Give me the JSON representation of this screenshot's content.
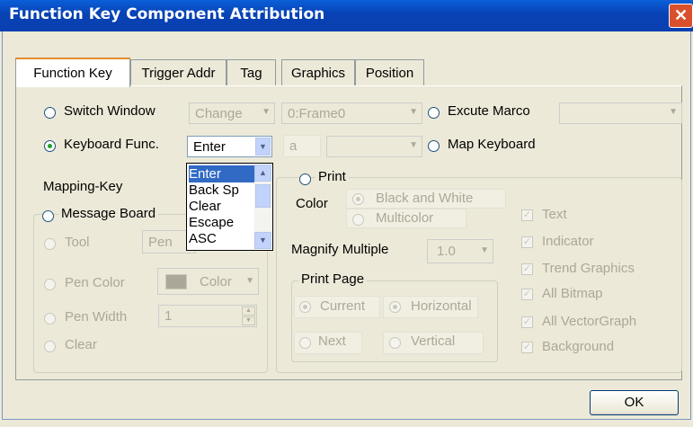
{
  "window": {
    "title": "Function Key Component Attribution",
    "close_glyph": "✕"
  },
  "tabs": [
    {
      "label": "Function Key"
    },
    {
      "label": "Trigger Addr"
    },
    {
      "label": "Tag"
    },
    {
      "label": "Graphics"
    },
    {
      "label": "Position"
    }
  ],
  "func": {
    "switch_window": "Switch Window",
    "switch_combo": "Change",
    "frame_combo": "0:Frame0",
    "excute_marco": "Excute Marco",
    "keyboard_func": "Keyboard Func.",
    "keyboard_combo": "Enter",
    "a_field": "a",
    "map_keyboard": "Map Keyboard",
    "mapping_key": "Mapping-Key",
    "dropdown_items": [
      "Enter",
      "Back Sp",
      "Clear",
      "Escape",
      "ASC"
    ]
  },
  "message_board": {
    "title": "Message Board",
    "tool": "Tool",
    "tool_combo": "Pen",
    "pen_color": "Pen Color",
    "color_combo": "Color",
    "pen_width": "Pen Width",
    "pen_width_value": "1",
    "clear": "Clear"
  },
  "print": {
    "title": "Print",
    "color": "Color",
    "black_white": "Black and White",
    "multicolor": "Multicolor",
    "magnify": "Magnify Multiple",
    "magnify_value": "1.0",
    "print_page": "Print Page",
    "current": "Current",
    "horizontal": "Horizontal",
    "next": "Next",
    "vertical": "Vertical",
    "checks": [
      "Text",
      "Indicator",
      "Trend Graphics",
      "All Bitmap",
      "All VectorGraph",
      "Background"
    ]
  },
  "buttons": {
    "ok": "OK"
  }
}
